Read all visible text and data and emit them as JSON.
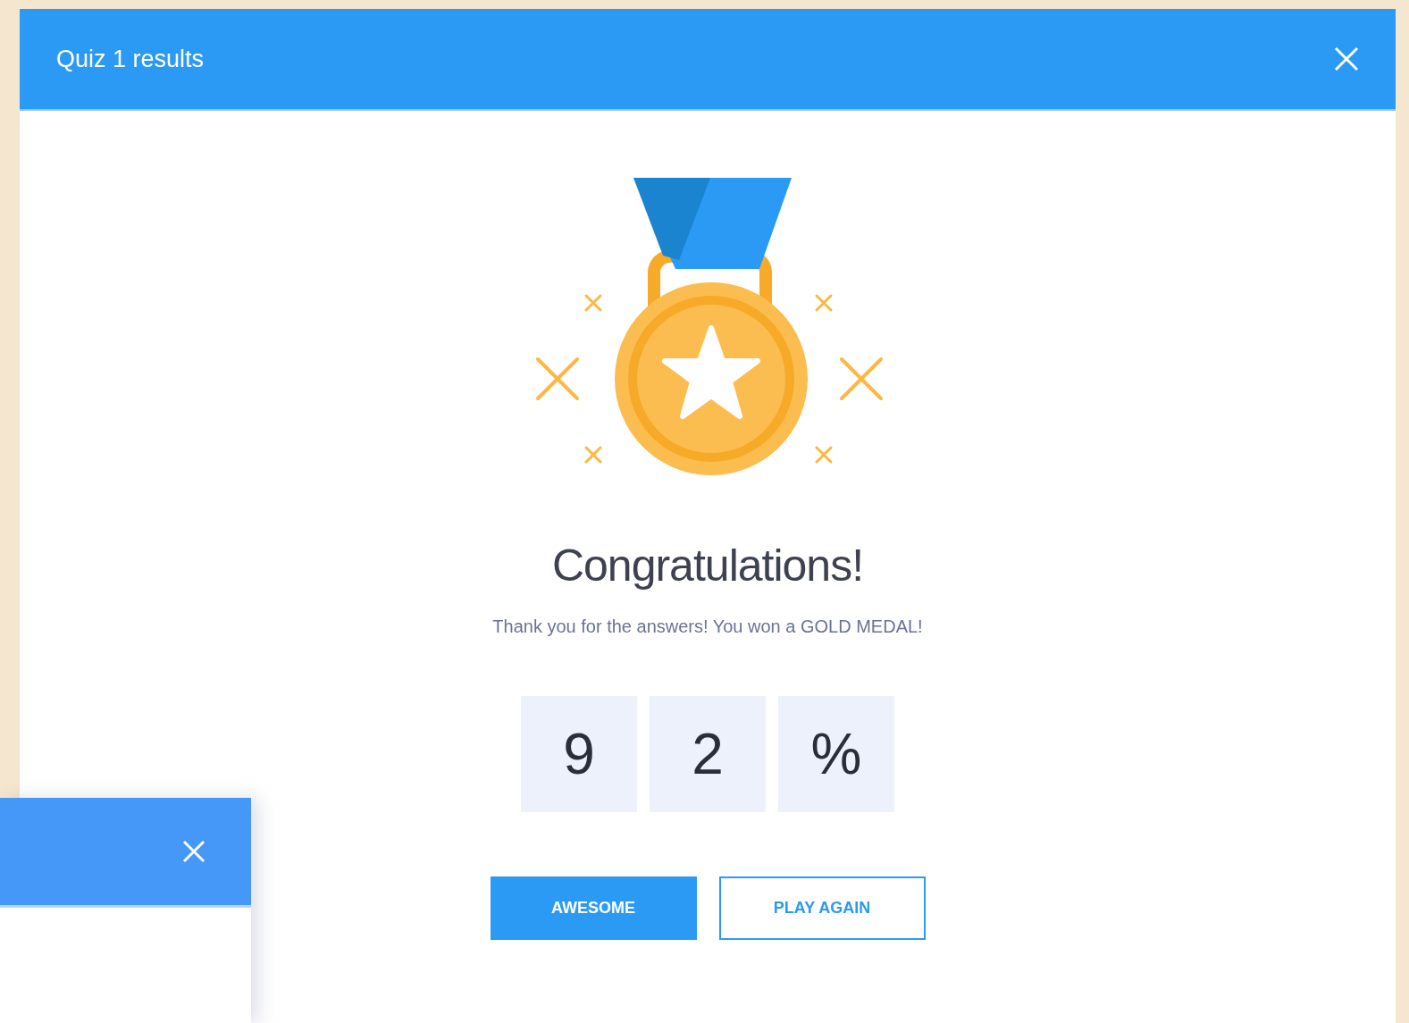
{
  "dialog": {
    "title": "Quiz 1 results",
    "heading": "Congratulations!",
    "message": "Thank you for the answers! You won a GOLD MEDAL!",
    "score_digits": [
      "9",
      "2",
      "%"
    ],
    "buttons": [
      {
        "label": "AWESOME",
        "kind": "primary"
      },
      {
        "label": "PLAY AGAIN",
        "kind": "secondary"
      }
    ]
  }
}
